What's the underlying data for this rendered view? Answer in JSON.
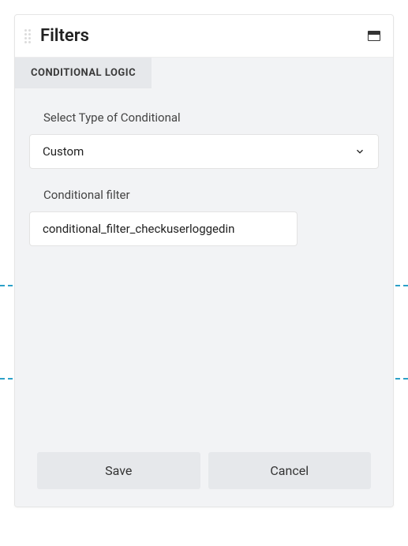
{
  "header": {
    "title": "Filters"
  },
  "tabs": {
    "conditional_logic": "CONDITIONAL LOGIC"
  },
  "fields": {
    "type_label": "Select Type of Conditional",
    "type_value": "Custom",
    "filter_label": "Conditional filter",
    "filter_value": "conditional_filter_checkuserloggedin"
  },
  "buttons": {
    "save": "Save",
    "cancel": "Cancel"
  }
}
